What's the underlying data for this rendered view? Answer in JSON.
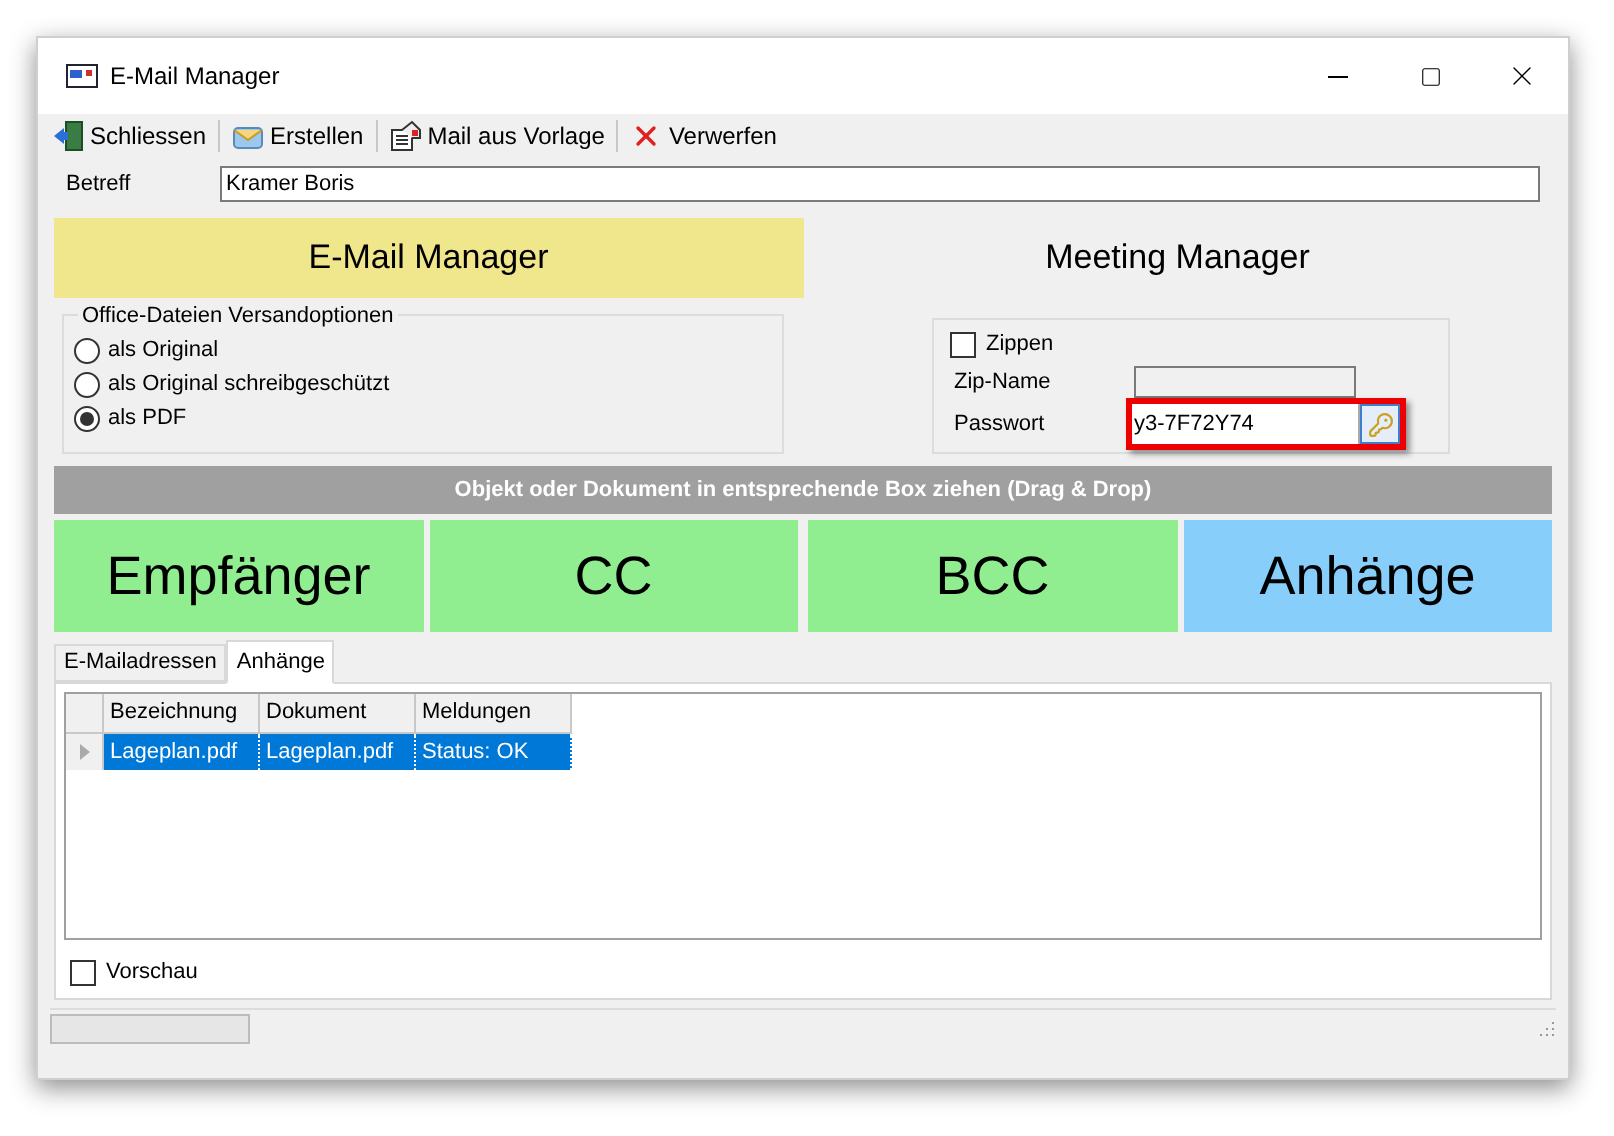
{
  "window": {
    "title": "E-Mail Manager"
  },
  "toolbar": [
    "Schliessen",
    "Erstellen",
    "Mail aus Vorlage",
    "Verwerfen"
  ],
  "subject": {
    "label": "Betreff",
    "value": "Kramer Boris"
  },
  "manager_tabs": [
    {
      "label": "E-Mail Manager",
      "selected": true
    },
    {
      "label": "Meeting Manager",
      "selected": false
    }
  ],
  "office_options": {
    "title": "Office-Dateien Versandoptionen",
    "options": [
      {
        "label": "als Original",
        "selected": false
      },
      {
        "label": "als Original schreibgeschützt",
        "selected": false
      },
      {
        "label": "als PDF",
        "selected": true
      }
    ]
  },
  "zip": {
    "label": "Zippen",
    "checked": false,
    "name_label": "Zip-Name",
    "password_label": "Passwort",
    "password": "y3-7F72Y74"
  },
  "drop_hint": "Objekt oder Dokument in entsprechende Box ziehen (Drag & Drop)",
  "drop_boxes": [
    {
      "label": "Empfänger",
      "color": "#90ee90"
    },
    {
      "label": "CC",
      "color": "#90ee90"
    },
    {
      "label": "BCC",
      "color": "#90ee90"
    },
    {
      "label": "Anhänge",
      "color": "#87cefa"
    }
  ],
  "tabs": [
    {
      "label": "E-Mailadressen",
      "selected": false
    },
    {
      "label": "Anhänge",
      "selected": true
    }
  ],
  "table": {
    "columns": [
      "Bezeichnung",
      "Dokument",
      "Meldungen"
    ],
    "rows": [
      {
        "cells": [
          "Lageplan.pdf",
          "Lageplan.pdf",
          "Status: OK"
        ],
        "selected": true
      }
    ]
  },
  "preview": {
    "label": "Vorschau",
    "checked": false
  },
  "status_bar": {
    "progress": {
      "level": 0
    }
  }
}
